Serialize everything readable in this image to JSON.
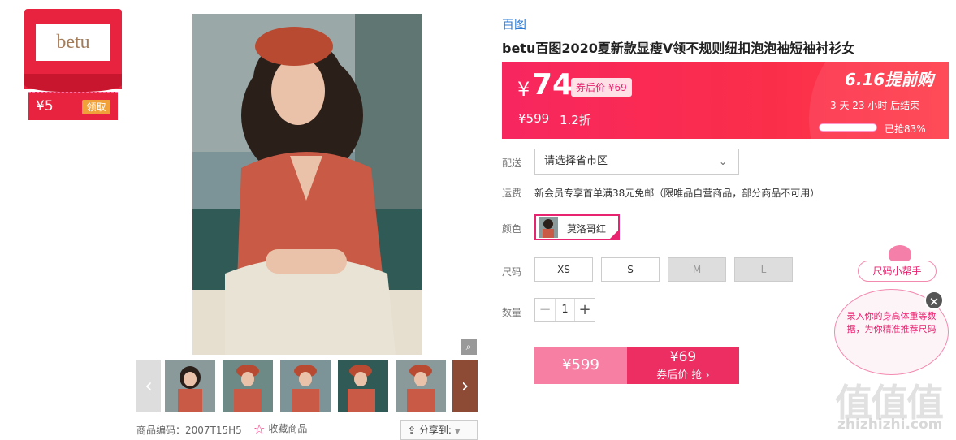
{
  "coupon": {
    "brand_logo": "betu",
    "amount": "¥5",
    "claim_label": "领取"
  },
  "gallery": {
    "share_label": "分享到:",
    "product_code": "商品编码：2007T15H5",
    "favorite_label": "收藏商品",
    "zoom_icon": "zoom-icon"
  },
  "product": {
    "brand": "百图",
    "title": "betu百图2020夏新款显瘦V领不规则纽扣泡泡袖短袖衬衫女",
    "currency": "¥",
    "price": "74",
    "after_coupon": "券后价 ¥69",
    "original_price": "¥599",
    "discount": "1.2折",
    "promo_title": "6.16提前购",
    "countdown": "3 天 23 小时 后结束",
    "sold_text": "已抢83%",
    "sold_fraction": 0.83
  },
  "options": {
    "delivery_label": "配送",
    "delivery_select": "请选择省市区",
    "shipping_label": "运费",
    "shipping_text": "新会员专享首单满38元免邮（限唯品自营商品，部分商品不可用）",
    "color_label": "颜色",
    "color_value": "莫洛哥红",
    "size_label": "尺码",
    "sizes": [
      "XS",
      "S",
      "M",
      "L"
    ],
    "qty_label": "数量",
    "qty_value": "1",
    "qty_minus": "−",
    "qty_plus": "+"
  },
  "buy": {
    "orig_price": "¥599",
    "coupon_price": "¥69",
    "coupon_label": "券后价 抢 ›"
  },
  "size_helper": {
    "title": "尺码小帮手",
    "text": "录入你的身高体重等数据，为你精准推荐尺码",
    "close": "✕"
  },
  "watermark": {
    "main": "值值值",
    "domain": "zhizhizhi.com"
  },
  "colors": {
    "accent": "#e8236f",
    "brand_blue": "#2c7bd5",
    "price_bar": "#f8265f"
  }
}
